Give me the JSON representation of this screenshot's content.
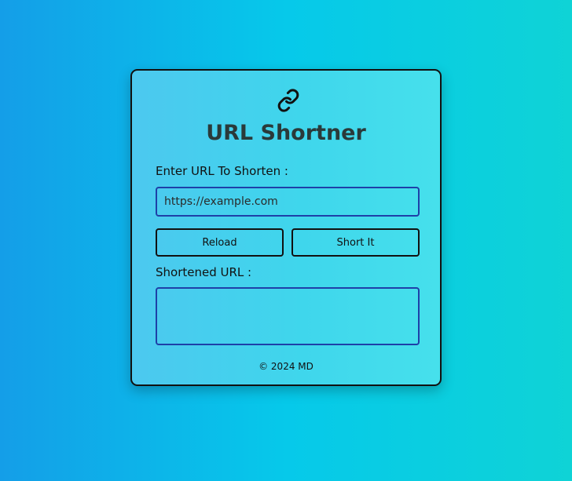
{
  "app": {
    "title": "URL Shortner",
    "logo_icon": "link-icon"
  },
  "form": {
    "input_label": "Enter URL To Shorten :",
    "input_placeholder": "https://example.com",
    "input_value": "",
    "reload_label": "Reload",
    "shorten_label": "Short It",
    "output_label": "Shortened URL :",
    "output_value": ""
  },
  "footer": {
    "text": "© 2024 MD"
  },
  "colors": {
    "background_start": "#149ee8",
    "background_end": "#0fd3d6",
    "card": "#46d4ee",
    "input_border": "#1e40a8",
    "title": "#2a3a3a"
  }
}
